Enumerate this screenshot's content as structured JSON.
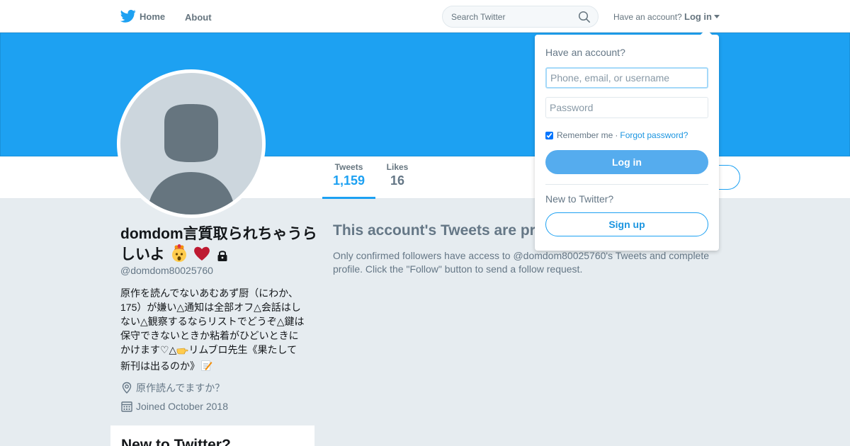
{
  "topbar": {
    "home_label": "Home",
    "about_label": "About",
    "search_placeholder": "Search Twitter",
    "have_account": "Have an account?",
    "login_label": "Log in"
  },
  "profile": {
    "name": "domdom言質取られちゃうらしいよ",
    "name_emojis": [
      "exploding-head-emoji",
      "red-heart-emoji",
      "lock-icon"
    ],
    "handle": "@domdom80025760",
    "bio_part1": "原作を読んでないあむあず厨（にわか、175）が嫌い△通知は全部オフ△会話はしない△観察するならリストでどうぞ△鍵は保守できないときか粘着がひどいときにかけます♡△",
    "bio_part2": "リムブロ先生《果たして新刊は出るのか》",
    "bio_emojis": [
      "pointing-hand-emoji",
      "memo-emoji"
    ],
    "location": "原作読んでますか？",
    "joined": "Joined October 2018"
  },
  "stats": {
    "tweets_label": "Tweets",
    "tweets_value": "1,159",
    "likes_label": "Likes",
    "likes_value": "16"
  },
  "protected": {
    "title": "This account's Tweets are protected.",
    "description": "Only confirmed followers have access to @domdom80025760's Tweets and complete profile. Click the \"Follow\" button to send a follow request."
  },
  "signup_card": {
    "title": "New to Twitter?"
  },
  "login_dropdown": {
    "heading": "Have an account?",
    "username_placeholder": "Phone, email, or username",
    "password_placeholder": "Password",
    "remember_label": "Remember me",
    "separator": "·",
    "forgot_label": "Forgot password?",
    "remember_checked": true,
    "login_button": "Log in",
    "new_to_twitter": "New to Twitter?",
    "signup_button": "Sign up"
  },
  "colors": {
    "brand_blue": "#1da1f2",
    "login_button": "#55acee",
    "page_bg": "#e6ecf0",
    "avatar_bg": "#ccd6dd",
    "avatar_silhouette": "#66757f"
  }
}
